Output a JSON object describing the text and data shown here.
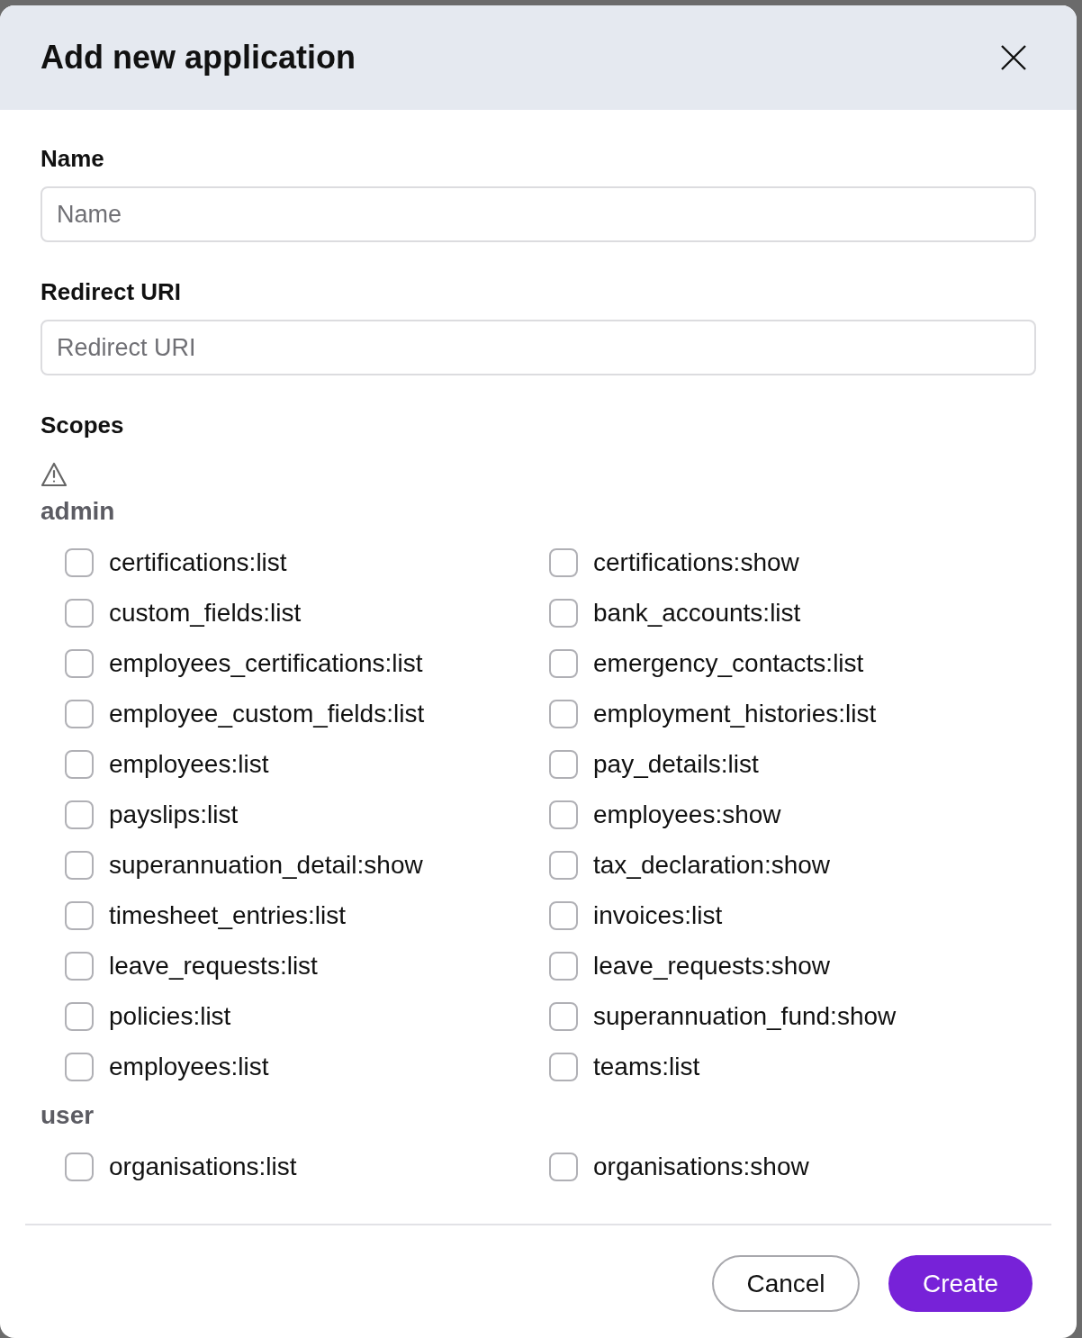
{
  "dialog": {
    "title": "Add new application"
  },
  "fields": [
    {
      "label": "Name",
      "placeholder": "Name"
    },
    {
      "label": "Redirect URI",
      "placeholder": "Redirect URI"
    }
  ],
  "scopes": {
    "label": "Scopes",
    "groups": [
      {
        "name": "admin",
        "items": [
          {
            "label": "certifications:list",
            "checked": false
          },
          {
            "label": "certifications:show",
            "checked": false
          },
          {
            "label": "custom_fields:list",
            "checked": false
          },
          {
            "label": "bank_accounts:list",
            "checked": false
          },
          {
            "label": "employees_certifications:list",
            "checked": false
          },
          {
            "label": "emergency_contacts:list",
            "checked": false
          },
          {
            "label": "employee_custom_fields:list",
            "checked": false
          },
          {
            "label": "employment_histories:list",
            "checked": false
          },
          {
            "label": "employees:list",
            "checked": false
          },
          {
            "label": "pay_details:list",
            "checked": false
          },
          {
            "label": "payslips:list",
            "checked": false
          },
          {
            "label": "employees:show",
            "checked": false
          },
          {
            "label": "superannuation_detail:show",
            "checked": false
          },
          {
            "label": "tax_declaration:show",
            "checked": false
          },
          {
            "label": "timesheet_entries:list",
            "checked": false
          },
          {
            "label": "invoices:list",
            "checked": false
          },
          {
            "label": "leave_requests:list",
            "checked": false
          },
          {
            "label": "leave_requests:show",
            "checked": false
          },
          {
            "label": "policies:list",
            "checked": false
          },
          {
            "label": "superannuation_fund:show",
            "checked": false
          },
          {
            "label": "employees:list",
            "checked": false
          },
          {
            "label": "teams:list",
            "checked": false
          }
        ]
      },
      {
        "name": "user",
        "items": [
          {
            "label": "organisations:list",
            "checked": false
          },
          {
            "label": "organisations:show",
            "checked": false
          }
        ]
      }
    ]
  },
  "buttons": [
    {
      "label": "Cancel",
      "kind": "secondary"
    },
    {
      "label": "Create",
      "kind": "primary"
    }
  ]
}
